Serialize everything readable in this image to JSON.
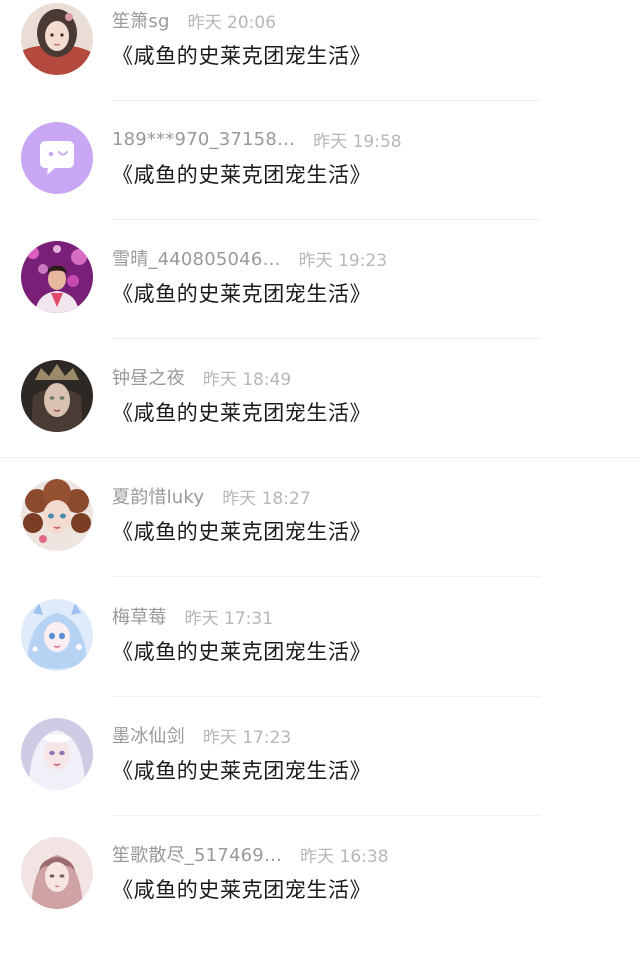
{
  "comments": [
    {
      "username": "笙箫sg",
      "time": "昨天 20:06",
      "text": "《咸鱼的史莱克团宠生活》",
      "avatar_icon": "avatar-girl-hanfu",
      "avatar_color": "#c8a79a"
    },
    {
      "username": "189***970_37158…",
      "time": "昨天 19:58",
      "text": "《咸鱼的史莱克团宠生活》",
      "avatar_icon": "default-chat-bubble-avatar",
      "avatar_color": "#c9a7f5"
    },
    {
      "username": "雪晴_440805046…",
      "time": "昨天 19:23",
      "text": "《咸鱼的史莱克团宠生活》",
      "avatar_icon": "avatar-person-pink-lights",
      "avatar_color": "#e04aa8"
    },
    {
      "username": "钟昼之夜",
      "time": "昨天 18:49",
      "text": "《咸鱼的史莱克团宠生活》",
      "avatar_icon": "avatar-crowned-doll",
      "avatar_color": "#3b3530"
    },
    {
      "username": "夏韵惜luky",
      "time": "昨天 18:27",
      "text": "《咸鱼的史莱克团宠生活》",
      "avatar_icon": "avatar-curly-hair-doll",
      "avatar_color": "#a76a48"
    },
    {
      "username": "梅草莓",
      "time": "昨天 17:31",
      "text": "《咸鱼的史莱克团宠生活》",
      "avatar_icon": "avatar-blue-anime-girl",
      "avatar_color": "#a9c8ef"
    },
    {
      "username": "墨冰仙剑",
      "time": "昨天 17:23",
      "text": "《咸鱼的史莱克团宠生活》",
      "avatar_icon": "avatar-white-hair-girl",
      "avatar_color": "#bcb8d6"
    },
    {
      "username": "笙歌散尽_517469…",
      "time": "昨天 16:38",
      "text": "《咸鱼的史莱克团宠生活》",
      "avatar_icon": "avatar-sketch-girl",
      "avatar_color": "#e6c7c8"
    }
  ]
}
